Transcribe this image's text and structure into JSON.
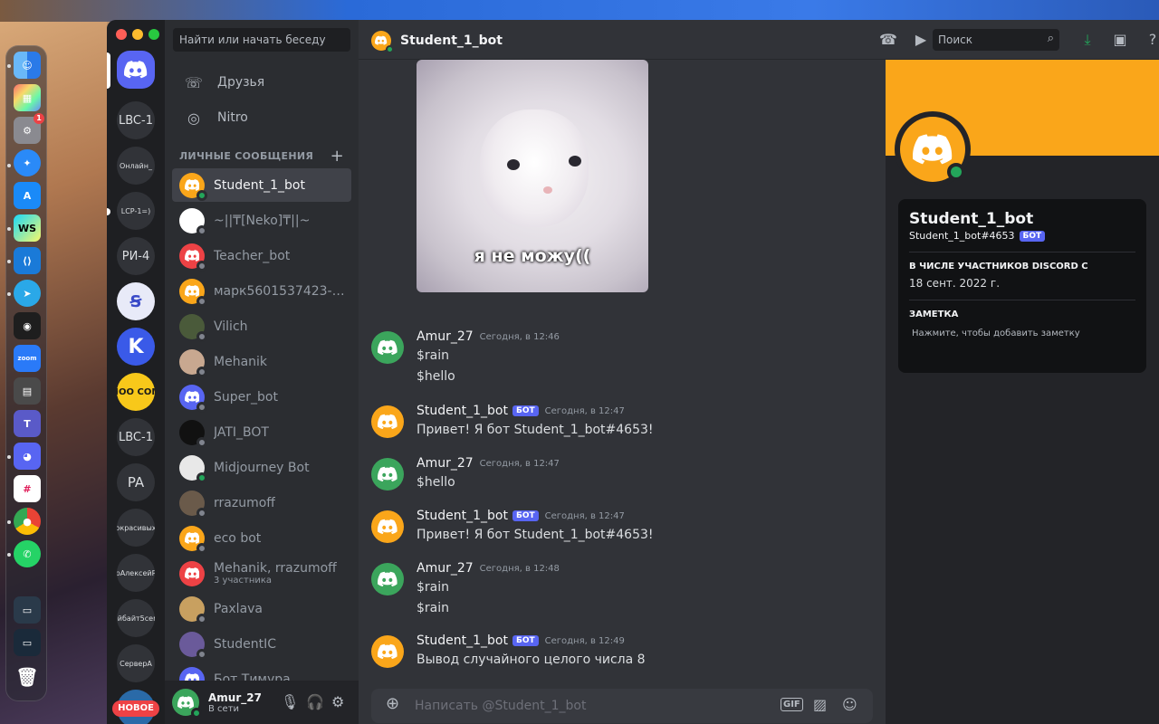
{
  "colors": {
    "discord_blurple": "#5865f2",
    "bot_orange": "#faa61a",
    "online_green": "#23a55a"
  },
  "dock": {
    "apps": [
      "finder-icon",
      "launchpad-icon",
      "system-settings-icon",
      "safari-icon",
      "app-store-icon",
      "webstorm-icon",
      "vscode-icon",
      "telegram-icon",
      "figma-icon",
      "zoom-icon",
      "calculator-icon",
      "teams-icon",
      "discord-icon",
      "slack-icon",
      "chrome-icon",
      "whatsapp-icon",
      "trash-icon"
    ],
    "zoom_label": "zoom",
    "ws_label": "WS",
    "settings_badge": "1"
  },
  "servers": [
    {
      "label": "LBC-1"
    },
    {
      "label": "Онлайн_"
    },
    {
      "label": "LCP-1=)"
    },
    {
      "label": "РИ-4"
    },
    {
      "label": ""
    },
    {
      "label": ""
    },
    {
      "label": "HOO COM"
    },
    {
      "label": "LBC-1"
    },
    {
      "label": "PA"
    },
    {
      "label": "окрасивых"
    },
    {
      "label": "рАлексейР"
    },
    {
      "label": "айбайт5сем"
    },
    {
      "label": "СерверА"
    }
  ],
  "server_new_badge": "НОВОЕ",
  "dm_sidebar": {
    "search_placeholder": "Найти или начать беседу",
    "friends_label": "Друзья",
    "nitro_label": "Nitro",
    "section_title": "ЛИЧНЫЕ СООБЩЕНИЯ",
    "add_icon": "+",
    "items": [
      {
        "name": "Student_1_bot",
        "status": "online",
        "color": "#faa61a"
      },
      {
        "name": "~||₸[Neko]₸||~",
        "status": "offline",
        "color": "#ffffff"
      },
      {
        "name": "Teacher_bot",
        "status": "offline",
        "color": "#ed4245"
      },
      {
        "name": "марк5601537423-456...",
        "status": "offline",
        "color": "#faa61a"
      },
      {
        "name": "Vilich",
        "status": "offline",
        "color": "#4a5a3a"
      },
      {
        "name": "Mehanik",
        "status": "offline",
        "color": "#c8a890"
      },
      {
        "name": "Super_bot",
        "status": "offline",
        "color": "#5865f2"
      },
      {
        "name": "JATI_BOT",
        "status": "offline",
        "color": "#111111"
      },
      {
        "name": "Midjourney Bot",
        "status": "online",
        "color": "#e8e8e8"
      },
      {
        "name": "rrazumoff",
        "status": "offline",
        "color": "#6a5a4a"
      },
      {
        "name": "eco bot",
        "status": "offline",
        "color": "#faa61a"
      },
      {
        "name": "Mehanik, rrazumoff",
        "sub": "3 участника",
        "status": "",
        "color": "#ed4245"
      },
      {
        "name": "Paxlava",
        "status": "offline",
        "color": "#c8a060"
      },
      {
        "name": "StudentIC",
        "status": "offline",
        "color": "#6a5a9a"
      },
      {
        "name": "Бот Тимура",
        "status": "",
        "color": "#5865f2"
      }
    ]
  },
  "user_panel": {
    "name": "Amur_27",
    "status": "В сети"
  },
  "chat": {
    "channel_name": "Student_1_bot",
    "search_placeholder": "Поиск",
    "image_caption": "я не можу((",
    "messages": [
      {
        "author": "Amur_27",
        "bot": false,
        "time": "Сегодня, в 12:46",
        "lines": [
          "$rain",
          "$hello"
        ]
      },
      {
        "author": "Student_1_bot",
        "bot": true,
        "time": "Сегодня, в 12:47",
        "lines": [
          "Привет! Я бот Student_1_bot#4653!"
        ]
      },
      {
        "author": "Amur_27",
        "bot": false,
        "time": "Сегодня, в 12:47",
        "lines": [
          "$hello"
        ]
      },
      {
        "author": "Student_1_bot",
        "bot": true,
        "time": "Сегодня, в 12:47",
        "lines": [
          "Привет! Я бот Student_1_bot#4653!"
        ]
      },
      {
        "author": "Amur_27",
        "bot": false,
        "time": "Сегодня, в 12:48",
        "lines": [
          "$rain",
          "$rain"
        ]
      },
      {
        "author": "Student_1_bot",
        "bot": true,
        "time": "Сегодня, в 12:49",
        "lines": [
          "Вывод случайного целого числа 8"
        ]
      }
    ],
    "bot_tag": "БОТ",
    "composer_placeholder": "Написать @Student_1_bot",
    "gif_label": "GIF"
  },
  "profile": {
    "name": "Student_1_bot",
    "tag": "Student_1_bot#4653",
    "bot_tag": "БОТ",
    "member_since_title": "В ЧИСЛЕ УЧАСТНИКОВ DISCORD С",
    "member_since": "18 сент. 2022 г.",
    "note_title": "ЗАМЕТКА",
    "note_placeholder": "Нажмите, чтобы добавить заметку"
  }
}
